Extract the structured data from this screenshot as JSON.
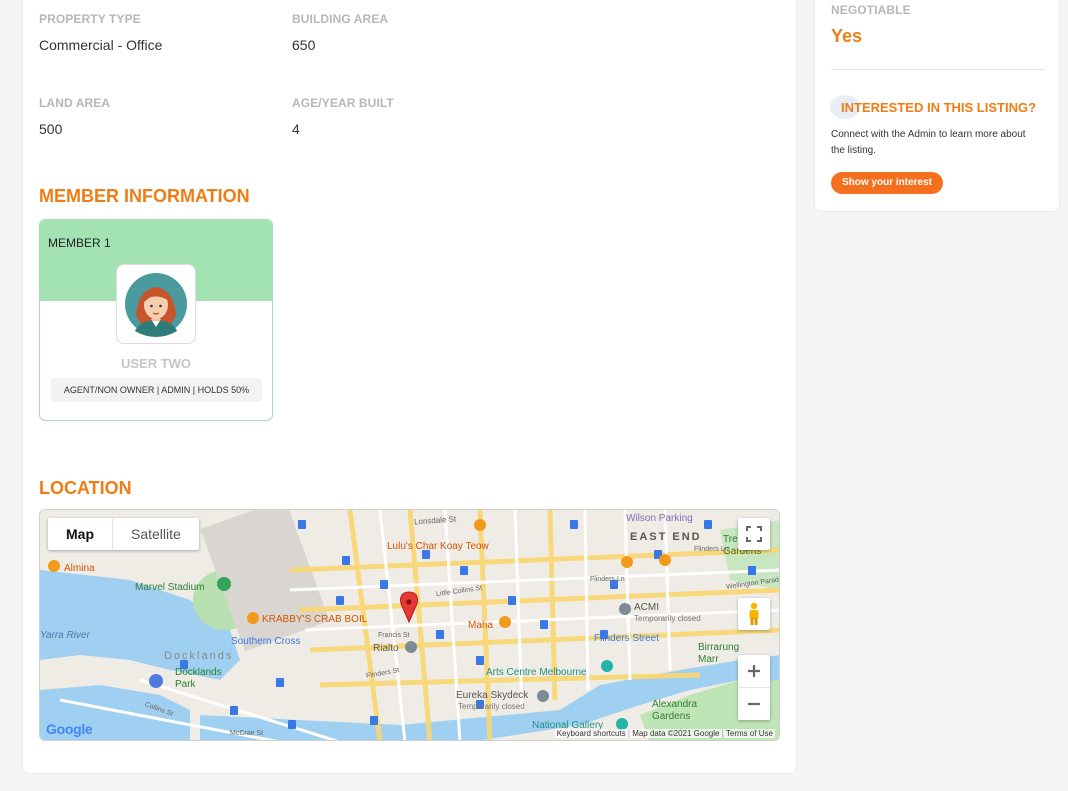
{
  "details": {
    "property_type_label": "PROPERTY TYPE",
    "property_type_value": "Commercial - Office",
    "building_area_label": "BUILDING AREA",
    "building_area_value": "650",
    "land_area_label": "LAND AREA",
    "land_area_value": "500",
    "age_label": "AGE/YEAR BUILT",
    "age_value": "4"
  },
  "member_section": {
    "title": "MEMBER INFORMATION",
    "member": {
      "label": "MEMBER 1",
      "name": "USER TWO",
      "roles": "AGENT/NON OWNER | ADMIN | HOLDS 50%"
    }
  },
  "location": {
    "title": "LOCATION",
    "map": {
      "tab_map": "Map",
      "tab_satellite": "Satellite",
      "places": [
        "Wilson Parking",
        "EAST END",
        "Lulu's Char Koay Teow",
        "Almina",
        "Marvel Stadium",
        "KRABBY'S CRAB BOIL",
        "Southern Cross",
        "Docklands",
        "Docklands Park",
        "Rialto",
        "Maha",
        "ACMI",
        "Temporarily closed",
        "Flinders Street",
        "Arts Centre Melbourne",
        "Birrarung Marr",
        "Eureka Skydeck",
        "Temporarily closed",
        "Alexandra Gardens",
        "National Gallery",
        "Yarra River",
        "Lonsdale St",
        "Little Collins St",
        "Flinders Ln",
        "Collins St",
        "McCrae St",
        "Wellington Parade",
        "Treasury Gardens",
        "Francis St",
        "Flinders St",
        "Flinders Ln"
      ],
      "footer": {
        "shortcuts": "Keyboard shortcuts",
        "data": "Map data ©2021 Google",
        "terms": "Terms of Use"
      },
      "logo": "Google"
    }
  },
  "sidebar": {
    "negotiable_label": "NEGOTIABLE",
    "negotiable_value": "Yes",
    "interest_title": "INTERESTED IN THIS LISTING?",
    "interest_text": "Connect with the Admin to learn more about the listing.",
    "interest_button": "Show your interest"
  },
  "colors": {
    "accent": "#f07c14",
    "member_header": "#a3e3b3",
    "button": "#f5701e"
  }
}
